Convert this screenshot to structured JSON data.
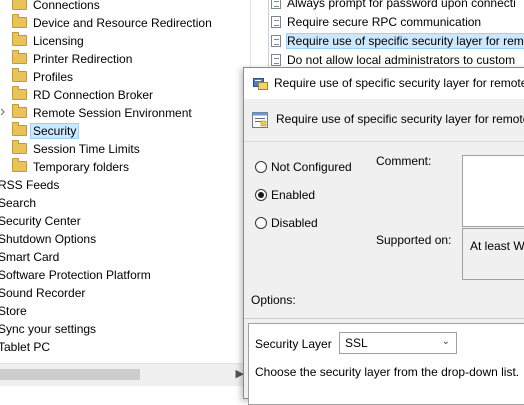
{
  "tree": {
    "items": [
      {
        "label": "Connections",
        "folder": true
      },
      {
        "label": "Device and Resource Redirection",
        "folder": true
      },
      {
        "label": "Licensing",
        "folder": true
      },
      {
        "label": "Printer Redirection",
        "folder": true
      },
      {
        "label": "Profiles",
        "folder": true
      },
      {
        "label": "RD Connection Broker",
        "folder": true
      },
      {
        "label": "Remote Session Environment",
        "folder": true,
        "expandable": true
      },
      {
        "label": "Security",
        "folder": true,
        "selected": true
      },
      {
        "label": "Session Time Limits",
        "folder": true
      },
      {
        "label": "Temporary folders",
        "folder": true
      },
      {
        "label": "RSS Feeds",
        "folder": false
      },
      {
        "label": "Search",
        "folder": false
      },
      {
        "label": "Security Center",
        "folder": false
      },
      {
        "label": "Shutdown Options",
        "folder": false
      },
      {
        "label": "Smart Card",
        "folder": false
      },
      {
        "label": "Software Protection Platform",
        "folder": false
      },
      {
        "label": "Sound Recorder",
        "folder": false
      },
      {
        "label": "Store",
        "folder": false
      },
      {
        "label": "Sync your settings",
        "folder": false
      },
      {
        "label": "Tablet PC",
        "folder": false
      }
    ]
  },
  "policy_list": {
    "rows": [
      {
        "label": "Always prompt for password upon connecti"
      },
      {
        "label": "Require secure RPC communication"
      },
      {
        "label": "Require use of specific security layer for rem",
        "selected": true
      },
      {
        "label": "Do not allow local administrators to custom"
      }
    ]
  },
  "dialog": {
    "title": "Require use of specific security layer for remote",
    "header": "Require use of specific security layer for remote",
    "radios": [
      {
        "label": "Not Configured",
        "checked": false
      },
      {
        "label": "Enabled",
        "checked": true
      },
      {
        "label": "Disabled",
        "checked": false
      }
    ],
    "comment_label": "Comment:",
    "supported_label": "Supported on:",
    "supported_value": "At least Wi",
    "options_label": "Options:",
    "security_layer_label": "Security Layer",
    "security_layer_value": "SSL",
    "security_layer_help": "Choose the security layer from the drop-down list."
  },
  "colors": {
    "selection": "#cce8ff",
    "folder": "#e8c35a",
    "dialog_bg": "#f0f0f0"
  }
}
